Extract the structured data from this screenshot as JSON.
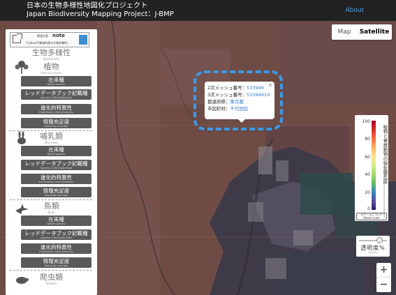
{
  "header": {
    "title_ja": "日本の生物多様性地図化プロジェクト",
    "title_en": "Japan Biodiversity Mapping Project：J-BMP",
    "about": "About"
  },
  "map_type": {
    "map": "Map",
    "satellite": "Satellite",
    "selected": "Satellite"
  },
  "book": {
    "line1": "関連記事",
    "note": "note",
    "line2": "「日本の47都道府県の生物多様性」"
  },
  "sidebar": {
    "biodiversity": {
      "ja": "生物多様性",
      "en": "Biodiversity"
    },
    "sections": [
      {
        "ja": "植物",
        "en": "Vascular plants",
        "icon": "plant-icon",
        "buttons": [
          {
            "ja": "在来種",
            "en": "Native species"
          },
          {
            "ja": "レッドデータブック記載種",
            "en": "Species in Red Data Book"
          },
          {
            "ja": "進化的特異性",
            "en": "Evolutionary distinctiveness"
          },
          {
            "ja": "情報充足度",
            "en": "Sampling coverage"
          }
        ]
      },
      {
        "ja": "哺乳類",
        "en": "Mammals",
        "icon": "rabbit-icon",
        "buttons": [
          {
            "ja": "在来種",
            "en": "Native species"
          },
          {
            "ja": "レッドデータブック記載種",
            "en": "Species in Red Data Book"
          },
          {
            "ja": "進化的特異性",
            "en": "Evolutionary distinctiveness"
          },
          {
            "ja": "情報充足度",
            "en": "Sampling coverage"
          }
        ]
      },
      {
        "ja": "鳥類",
        "en": "Birds",
        "icon": "bird-icon",
        "buttons": [
          {
            "ja": "在来種",
            "en": "Native species"
          },
          {
            "ja": "レッドデータブック記載種",
            "en": "Species in Red Data Book"
          },
          {
            "ja": "進化的特異性",
            "en": "Evolutionary distinctiveness"
          },
          {
            "ja": "情報充足度",
            "en": "Sampling coverage"
          }
        ]
      },
      {
        "ja": "爬虫類",
        "en": "Reptiles",
        "icon": "turtle-icon",
        "buttons": []
      }
    ]
  },
  "popup": {
    "mesh2_label": "2次メッシュ番号：",
    "mesh2_value": "533946",
    "mesh3_label": "3次メッシュ番号：",
    "mesh3_value": "53394610",
    "pref_label": "都道府県：",
    "pref_value": "東京都",
    "city_label": "市区町村：",
    "city_value": "千代田区",
    "close": "×"
  },
  "legend": {
    "max": "100",
    "ticks": [
      "100",
      "80",
      "60",
      "40",
      "20",
      "0"
    ],
    "title_ja": "植物と脊椎動物の保全優先度",
    "title_en": "Conservation priority of plants and vertebrates",
    "about_scale_ja": "スケールについて",
    "about_scale_en": "About scale",
    "colors": [
      "#a50026",
      "#f46d43",
      "#fee08b",
      "#a6d96a",
      "#3288bd",
      "#2d1b6b"
    ]
  },
  "opacity": {
    "label": "透明度%",
    "sub": "Opacity",
    "value": 0.7
  },
  "zoom": {
    "in": "+",
    "out": "−"
  }
}
